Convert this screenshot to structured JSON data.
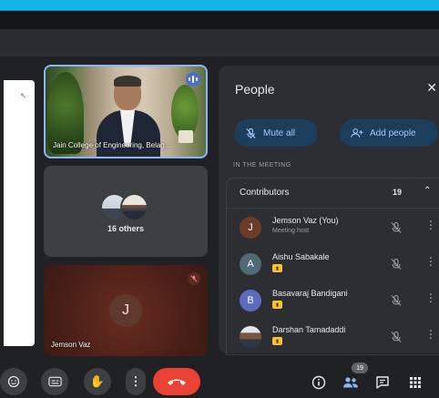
{
  "colors": {
    "accent": "#8ab4f8",
    "end_call": "#ea4335",
    "pill_bg": "#1a3e5c",
    "badge": "#f9c22c"
  },
  "tiles": {
    "featured": {
      "name": "Jain College of Engineering, Belag..."
    },
    "others": {
      "label": "16 others"
    },
    "self": {
      "initial": "J",
      "name": "Jemson Vaz"
    }
  },
  "people_panel": {
    "title": "People",
    "mute_all_label": "Mute all",
    "add_people_label": "Add people",
    "section_label": "IN THE MEETING",
    "contributors": {
      "label": "Contributors",
      "count": "19",
      "members": [
        {
          "initial": "J",
          "name": "Jemson Vaz (You)",
          "subtitle": "Meeting host",
          "avatar_color": "#6d3b2a",
          "badge": false,
          "avatar_type": "letter"
        },
        {
          "initial": "A",
          "name": "Aishu Sabakale",
          "subtitle": "",
          "avatar_color": "#4f6b75",
          "badge": true,
          "avatar_type": "letter"
        },
        {
          "initial": "B",
          "name": "Basavaraj Bandigani",
          "subtitle": "",
          "avatar_color": "#5c6bc0",
          "badge": true,
          "avatar_type": "letter"
        },
        {
          "initial": "",
          "name": "Darshan Tamadaddi",
          "subtitle": "",
          "avatar_color": "#c0ccd8",
          "badge": true,
          "avatar_type": "photo"
        }
      ]
    }
  },
  "bottom_bar": {
    "people_count": "19",
    "icons": [
      "emoji-icon",
      "captions-icon",
      "raise-hand-icon",
      "more-options-icon",
      "end-call-icon",
      "info-icon",
      "people-icon",
      "chat-icon",
      "activities-icon"
    ]
  }
}
